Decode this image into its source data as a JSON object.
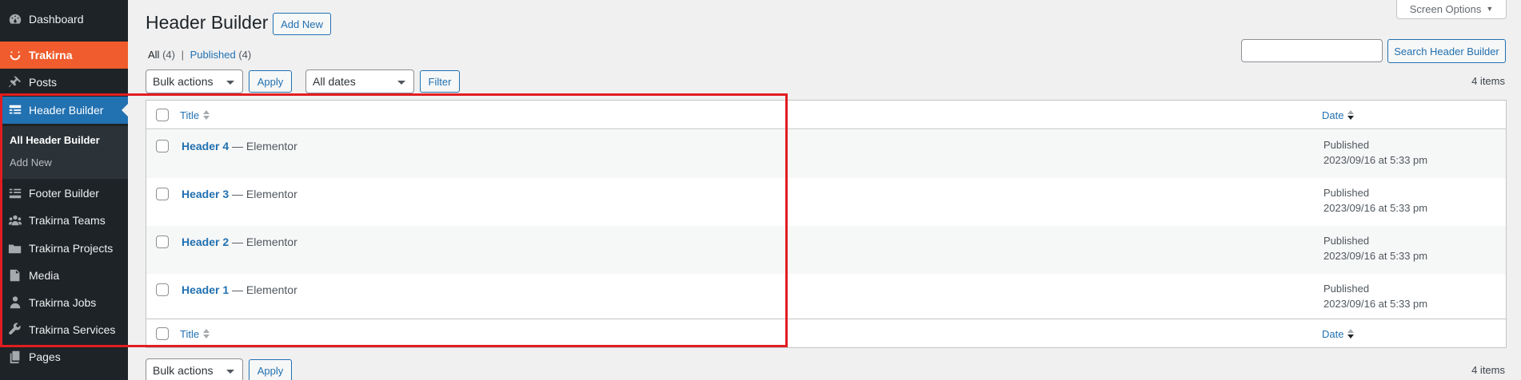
{
  "sidebar": {
    "items": [
      {
        "label": "Dashboard",
        "icon": "dashboard-icon"
      },
      {
        "label": "Trakirna",
        "icon": "smile-icon"
      },
      {
        "label": "Posts",
        "icon": "pin-icon"
      },
      {
        "label": "Header Builder",
        "icon": "header-icon"
      },
      {
        "label": "Footer Builder",
        "icon": "footer-icon"
      },
      {
        "label": "Trakirna Teams",
        "icon": "groups-icon"
      },
      {
        "label": "Trakirna Projects",
        "icon": "folder-icon"
      },
      {
        "label": "Media",
        "icon": "media-icon"
      },
      {
        "label": "Trakirna Jobs",
        "icon": "businessperson-icon"
      },
      {
        "label": "Trakirna Services",
        "icon": "wrench-icon"
      },
      {
        "label": "Pages",
        "icon": "page-icon"
      }
    ],
    "submenu": [
      {
        "label": "All Header Builder"
      },
      {
        "label": "Add New"
      }
    ]
  },
  "page": {
    "title": "Header Builder",
    "add_new": "Add New",
    "screen_options": "Screen Options",
    "search_button": "Search Header Builder",
    "filters": {
      "all_label": "All",
      "all_count": "(4)",
      "separator": "|",
      "published_label": "Published",
      "published_count": "(4)"
    },
    "bulk_actions": "Bulk actions",
    "apply": "Apply",
    "all_dates": "All dates",
    "filter": "Filter",
    "items_count": "4 items"
  },
  "table": {
    "col_title": "Title",
    "col_date": "Date",
    "rows": [
      {
        "title": "Header 4",
        "suffix": "— Elementor",
        "status": "Published",
        "date": "2023/09/16 at 5:33 pm"
      },
      {
        "title": "Header 3",
        "suffix": "— Elementor",
        "status": "Published",
        "date": "2023/09/16 at 5:33 pm"
      },
      {
        "title": "Header 2",
        "suffix": "— Elementor",
        "status": "Published",
        "date": "2023/09/16 at 5:33 pm"
      },
      {
        "title": "Header 1",
        "suffix": "— Elementor",
        "status": "Published",
        "date": "2023/09/16 at 5:33 pm"
      }
    ]
  },
  "colors": {
    "sidebar_bg": "#1d2327",
    "brand": "#f05c2d",
    "accent": "#2271b1",
    "highlight": "#e11d21"
  }
}
